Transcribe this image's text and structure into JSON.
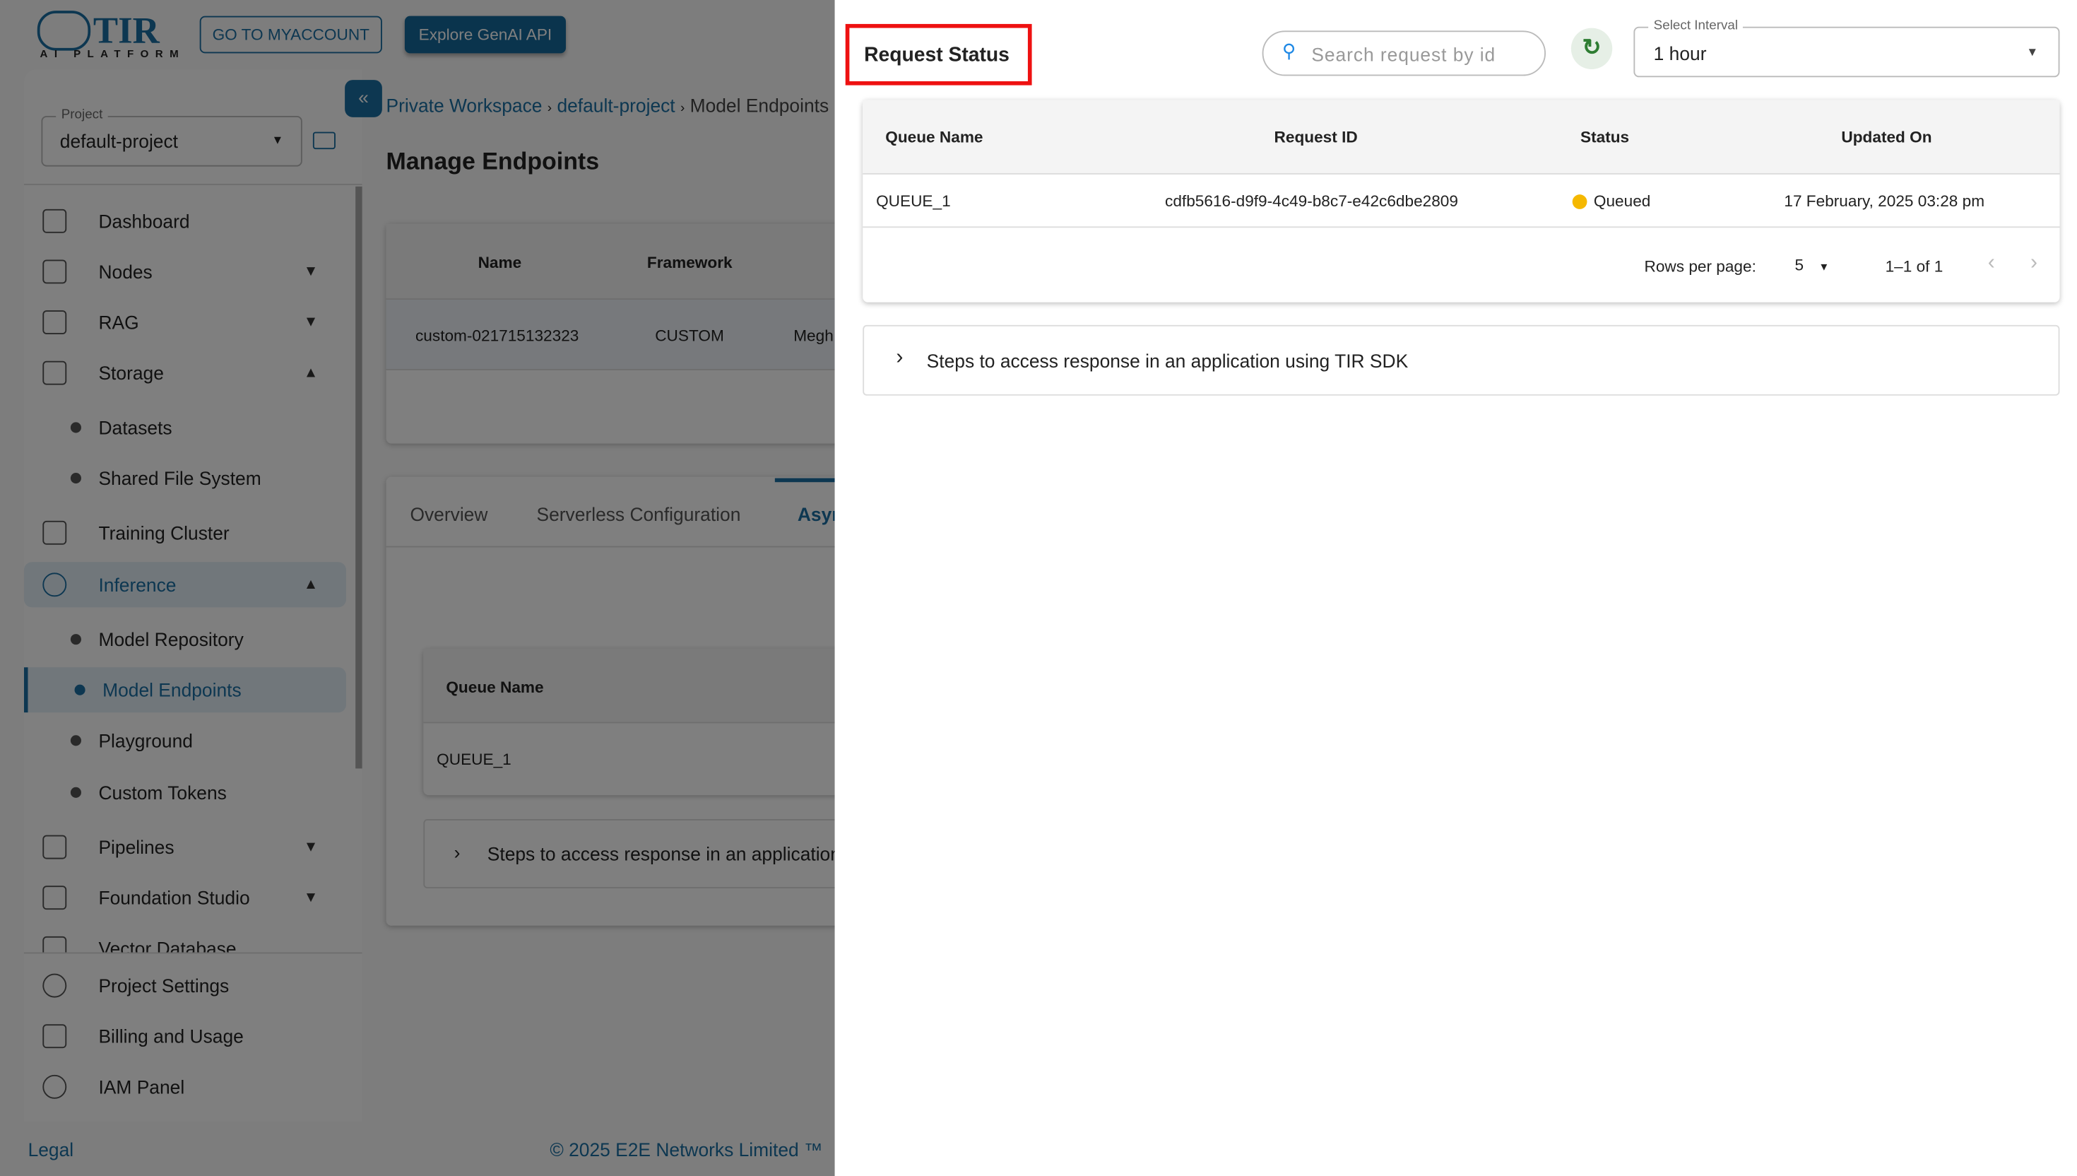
{
  "header": {
    "logo_text": "TIR",
    "logo_subtitle": "AI PLATFORM",
    "myaccount_label": "GO TO MYACCOUNT",
    "genai_label": "Explore GenAI API"
  },
  "sidebar": {
    "project_label": "Project",
    "project_value": "default-project",
    "items": [
      {
        "label": "Dashboard"
      },
      {
        "label": "Nodes"
      },
      {
        "label": "RAG"
      },
      {
        "label": "Storage"
      },
      {
        "label": "Datasets"
      },
      {
        "label": "Shared File System"
      },
      {
        "label": "Training Cluster"
      },
      {
        "label": "Inference"
      },
      {
        "label": "Model Repository"
      },
      {
        "label": "Model Endpoints"
      },
      {
        "label": "Playground"
      },
      {
        "label": "Custom Tokens"
      },
      {
        "label": "Pipelines"
      },
      {
        "label": "Foundation Studio"
      },
      {
        "label": "Vector Database"
      }
    ],
    "bottom_items": [
      {
        "label": "Project Settings"
      },
      {
        "label": "Billing and Usage"
      },
      {
        "label": "IAM Panel"
      }
    ]
  },
  "footer": {
    "legal": "Legal",
    "copyright": "© 2025 E2E Networks Limited ™"
  },
  "main": {
    "breadcrumb": [
      "Private Workspace",
      "default-project",
      "Model Endpoints"
    ],
    "title": "Manage Endpoints",
    "table": {
      "headers": [
        "Name",
        "Framework"
      ],
      "row": [
        "custom-021715132323",
        "CUSTOM",
        "Megh"
      ]
    },
    "tabs": [
      "Overview",
      "Serverless Configuration",
      "Async"
    ],
    "queue_header": "Queue Name",
    "queue_value": "QUEUE_1",
    "accordion": "Steps to access response in an application using TIR SDK"
  },
  "drawer": {
    "title": "Request Status",
    "search_placeholder": "Search request by id",
    "interval_label": "Select Interval",
    "interval_value": "1 hour",
    "columns": [
      "Queue Name",
      "Request ID",
      "Status",
      "Updated On"
    ],
    "rows": [
      {
        "queue": "QUEUE_1",
        "request_id": "cdfb5616-d9f9-4c49-b8c7-e42c6dbe2809",
        "status": "Queued",
        "updated": "17 February, 2025 03:28 pm"
      }
    ],
    "status_color": "#f5b800",
    "rows_per_page_label": "Rows per page:",
    "rows_per_page": "5",
    "range": "1–1 of 1",
    "accordion": "Steps to access response in an application using TIR SDK"
  }
}
